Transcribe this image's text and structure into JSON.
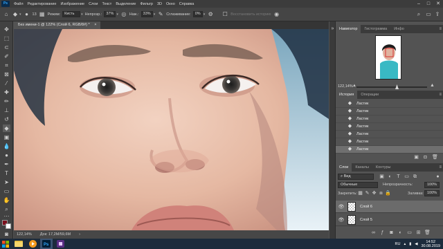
{
  "menu": {
    "items": [
      "Файл",
      "Редактирование",
      "Изображение",
      "Слои",
      "Текст",
      "Выделение",
      "Фильтр",
      "3D",
      "Окно",
      "Справка"
    ],
    "logo": "Ps"
  },
  "window_controls": {
    "minimize": "–",
    "maximize": "□",
    "close": "✕"
  },
  "options": {
    "brush_size": "13",
    "mode_label": "Режим:",
    "mode_value": "Кисть",
    "opacity_label": "Непрозр.:",
    "opacity_value": "37%",
    "pressure_label": "Наж.:",
    "pressure_value": "33%",
    "smoothing_label": "Сглаживание:",
    "smoothing_value": "0%",
    "history_erase_label": "Восстановить историю"
  },
  "document": {
    "tab_title": "Без имени-1 @ 122% (Слой 6, RGB/8#) *",
    "tab_close": "×",
    "status_zoom": "122,14%",
    "status_doc": "Док: 17,2M/59,6M"
  },
  "panels": {
    "nav_tabs": [
      "Навигатор",
      "Гистограмма",
      "Инфо"
    ],
    "nav_zoom": "122,14%",
    "history_tabs": [
      "История",
      "Операции"
    ],
    "history_items": [
      "Ластик",
      "Ластик",
      "Ластик",
      "Ластик",
      "Ластик",
      "Ластик",
      "Ластик"
    ],
    "layers_tabs": [
      "Слои",
      "Каналы",
      "Контуры"
    ],
    "layers_filter": "Вид",
    "blend_mode": "Обычные",
    "opacity_label": "Непрозрачность:",
    "opacity_value": "100%",
    "lock_label": "Закрепить:",
    "fill_label": "Заливка:",
    "fill_value": "100%",
    "layers": [
      {
        "name": "Слой 6",
        "selected": true
      },
      {
        "name": "Слой 5",
        "selected": false
      }
    ]
  },
  "taskbar": {
    "lang": "RU",
    "time": "14:52",
    "date": "30.08.2019"
  },
  "colors": {
    "accent": "#31a8ff",
    "foreground_swatch": "#7a0f1c",
    "background_swatch": "#ffffff"
  }
}
